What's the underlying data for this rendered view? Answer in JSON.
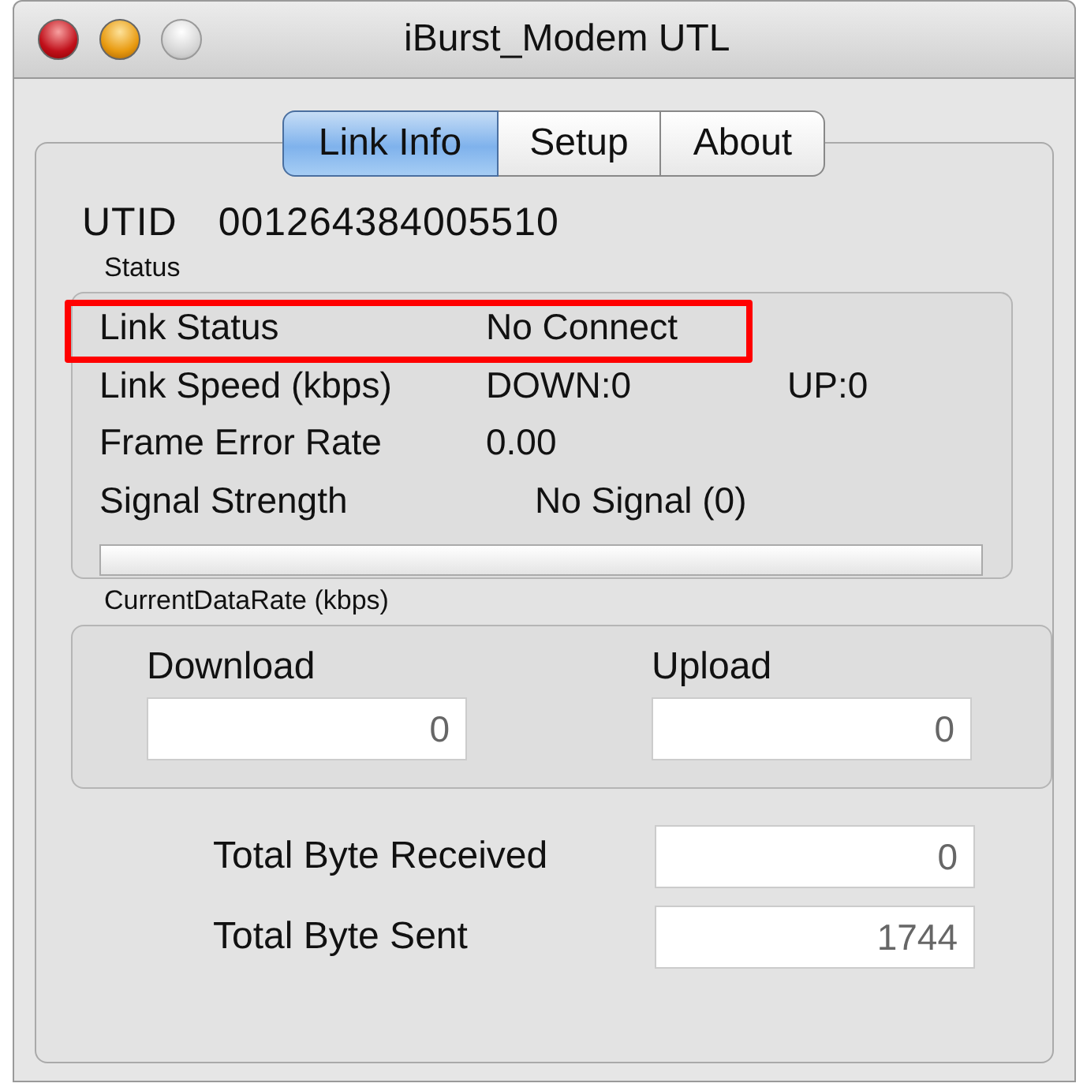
{
  "window": {
    "title": "iBurst_Modem UTL"
  },
  "tabs": [
    {
      "label": "Link Info",
      "selected": true
    },
    {
      "label": "Setup",
      "selected": false
    },
    {
      "label": "About",
      "selected": false
    }
  ],
  "utid": {
    "label": "UTID",
    "value": "001264384005510"
  },
  "status": {
    "title": "Status",
    "rows": [
      {
        "label": "Link Status",
        "value": "No Connect",
        "highlighted": true
      },
      {
        "label": "Link Speed (kbps)",
        "value": "DOWN:0",
        "value_2": "UP:0",
        "highlighted": false
      },
      {
        "label": "Frame Error Rate",
        "value": "0.00",
        "highlighted": false
      },
      {
        "label": "Signal Strength",
        "value_2": "No Signal (0)",
        "highlighted": false
      }
    ],
    "signal_bar": {
      "level": 0
    }
  },
  "data_rate": {
    "title": "CurrentDataRate (kbps)",
    "fields": [
      {
        "label": "Download",
        "value": "0"
      },
      {
        "label": "Upload",
        "value": "0"
      }
    ]
  },
  "totals": [
    {
      "label": "Total Byte Received",
      "value": "0"
    },
    {
      "label": "Total Byte Sent",
      "value": "1744"
    }
  ]
}
